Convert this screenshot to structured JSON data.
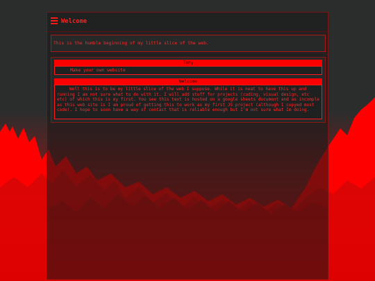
{
  "header": {
    "title": "Welcome",
    "menu_icon": "hamburger-menu-icon"
  },
  "intro": {
    "text": "This is the humble beginning of my little slice of the web."
  },
  "sections": {
    "tony": {
      "heading": "Tony",
      "items": [
        "Make your own website"
      ]
    },
    "welcome": {
      "heading": "Welcome",
      "body": "Well this is to be my little slice of the web I suppose. While it is neat to have this up and running I am not sure what to do with it. I will add stuff for projects (coding, visual design, etc etc) of which this is my first. You see this text is hosted on a google sheets document and as incomple as this web site is I am proud of getting this to work as my first JS project (although I copyed most code). I hope to soon have a way of contact that is reliable enough but I'm not sure what Im doing."
    }
  },
  "colors": {
    "accent": "#ff1a1a",
    "background": "#2b2d2d",
    "panel": "#272828",
    "forest_light": "#ff0000",
    "forest_dark": "#8c0e0e"
  }
}
